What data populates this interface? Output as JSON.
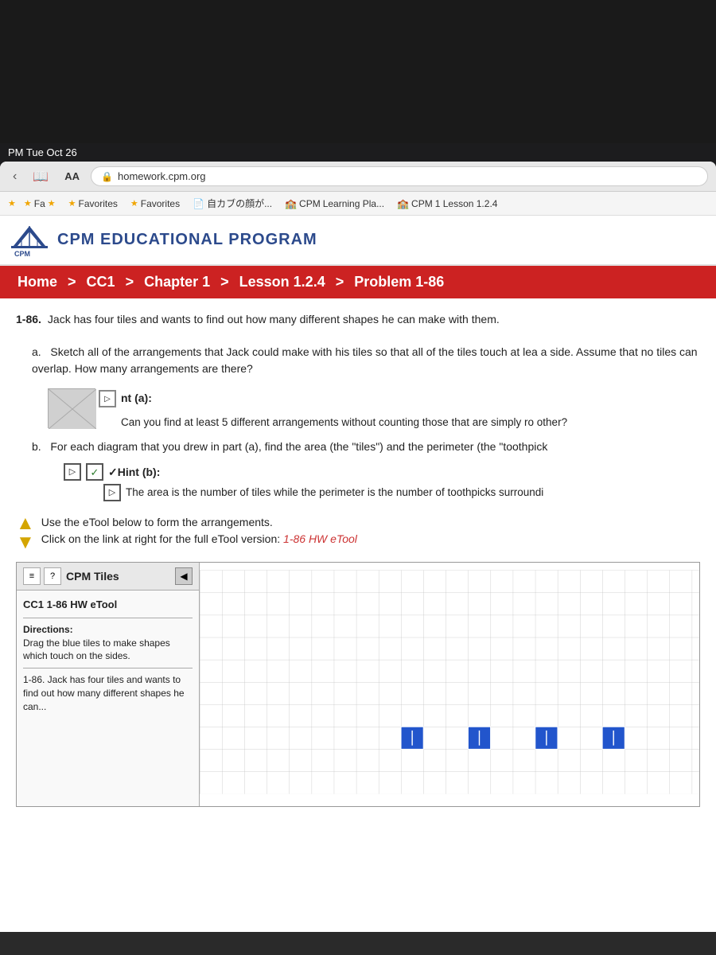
{
  "statusBar": {
    "time": "PM  Tue Oct 26"
  },
  "browserNav": {
    "aaLabel": "AA",
    "addressUrl": "homework.cpm.org",
    "lockSymbol": "🔒"
  },
  "bookmarks": {
    "items": [
      {
        "id": "fa",
        "label": "Fa",
        "star": true
      },
      {
        "id": "favorites1",
        "label": "Favorites",
        "star": true
      },
      {
        "id": "favorites2",
        "label": "Favorites",
        "star": true
      },
      {
        "id": "jikabu",
        "label": "自カブの顔が...",
        "icon": "📄"
      },
      {
        "id": "cpm-learning",
        "label": "Learning Pla...",
        "icon": "🏫"
      },
      {
        "id": "lesson",
        "label": "1 Lesson 1.2.4",
        "icon": "🏫"
      }
    ]
  },
  "header": {
    "orgName": "CPM EDUCATIONAL PROGRAM"
  },
  "breadcrumb": {
    "items": [
      "Home",
      "CC1",
      "Chapter 1",
      "Lesson 1.2.4",
      "Problem 1-86"
    ],
    "separators": [
      ">",
      ">",
      ">",
      ">"
    ]
  },
  "problem": {
    "number": "1-86.",
    "intro": "Jack has four tiles and wants to find out how many different shapes he can make with them.",
    "partA": {
      "label": "a.",
      "text": "Sketch all of the arrangements that Jack could make with his tiles so that all of the tiles touch at lea a side. Assume that no tiles can overlap. How many arrangements are there?",
      "hintA_label": "nt (a):",
      "hintA_content": "Can you find at least 5 different arrangements without counting those that are simply ro other?",
      "hintA_icon": "▷"
    },
    "partB": {
      "label": "b.",
      "text": "For each diagram that you drew in part (a), find the area (the \"tiles\") and the perimeter (the \"toothpick",
      "hintB_label": "✓Hint (b):",
      "hintB_icon": "▷",
      "hintB_content": "The area is the number of tiles while the perimeter is the number of toothpicks surroundi"
    }
  },
  "etoolSection": {
    "line1": "Use the eTool below to form the arrangements.",
    "line2prefix": "Click on the link at right for the full eTool version: ",
    "linkText": "1-86 HW eTool",
    "widget": {
      "iconBtns": [
        "≡",
        "?"
      ],
      "collapseBtn": "◀",
      "title": "CPM Tiles",
      "subtitle": "CC1 1-86 HW eTool",
      "directionsLabel": "Directions:",
      "directionsText": "Drag the blue tiles to make shapes which touch on the sides.",
      "problemText": "1-86. Jack has four tiles and wants to find out how many different shapes he can..."
    }
  }
}
